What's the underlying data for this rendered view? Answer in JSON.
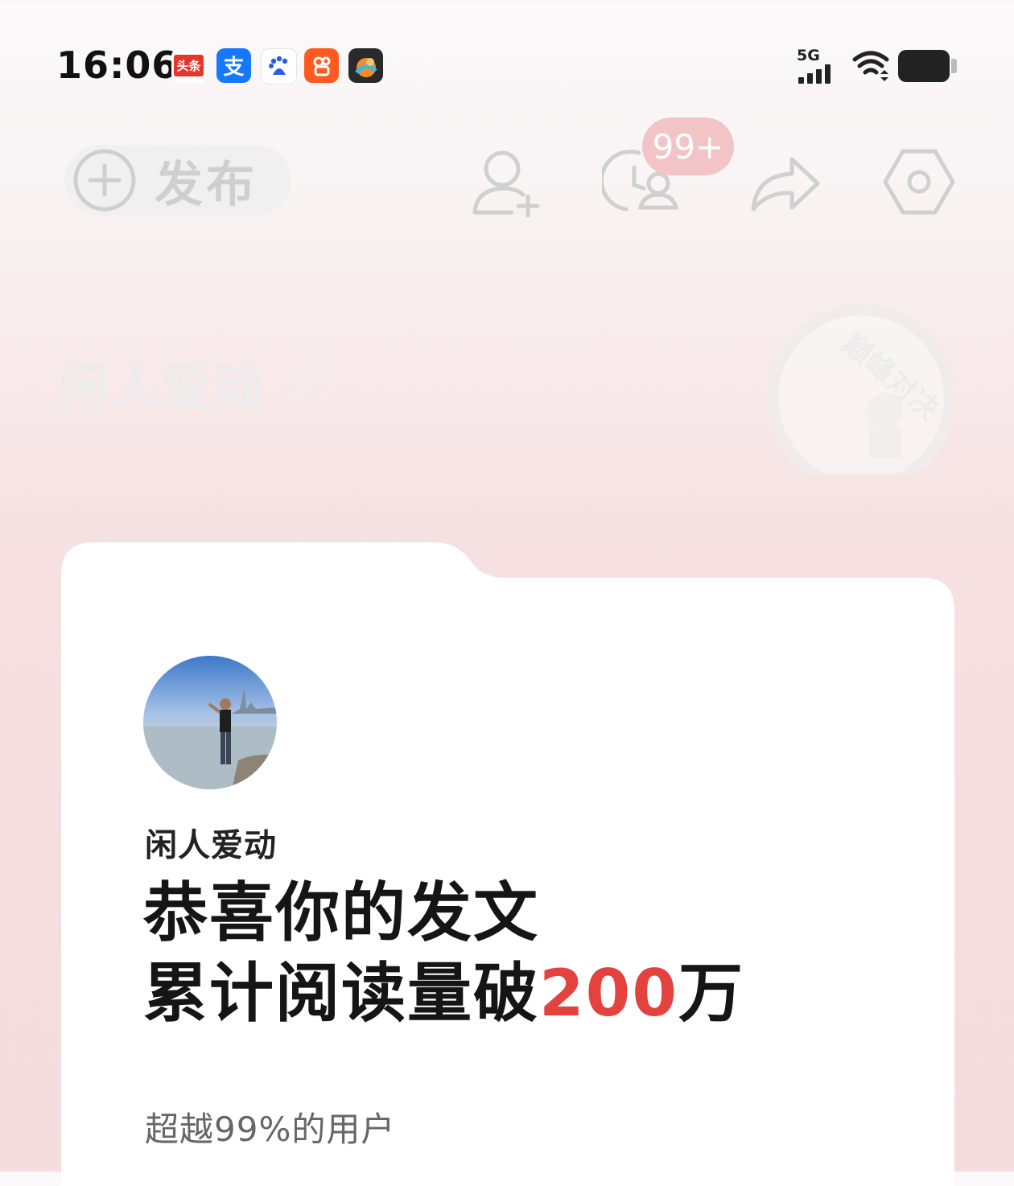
{
  "status_bar": {
    "time": "16:06",
    "app_icons": [
      {
        "name": "toutiao-app-icon",
        "label": "头条",
        "color": "#e8352c"
      },
      {
        "name": "alipay-app-icon",
        "label": "支",
        "color": "#1677ff"
      },
      {
        "name": "baidu-app-icon",
        "label": "du",
        "color": "#ffffff"
      },
      {
        "name": "kuaishou-app-icon",
        "label": "",
        "color": "#ff5a1f"
      },
      {
        "name": "game-app-icon",
        "label": "",
        "color": "#2b2b2b"
      }
    ],
    "network_label": "5G"
  },
  "toolbar": {
    "publish_label": "发布",
    "notification_badge": "99+"
  },
  "profile": {
    "name": "闲人爱动",
    "badge_text": "巅峰对决"
  },
  "card": {
    "name": "闲人爱动",
    "headline_line1": "恭喜你的发文",
    "headline_line2_prefix": "累计阅读量破",
    "headline_number": "200",
    "headline_suffix": "万",
    "subline": "超越99%的用户"
  },
  "colors": {
    "accent_red": "#e4423f",
    "badge_pink": "#f3c4c5"
  }
}
